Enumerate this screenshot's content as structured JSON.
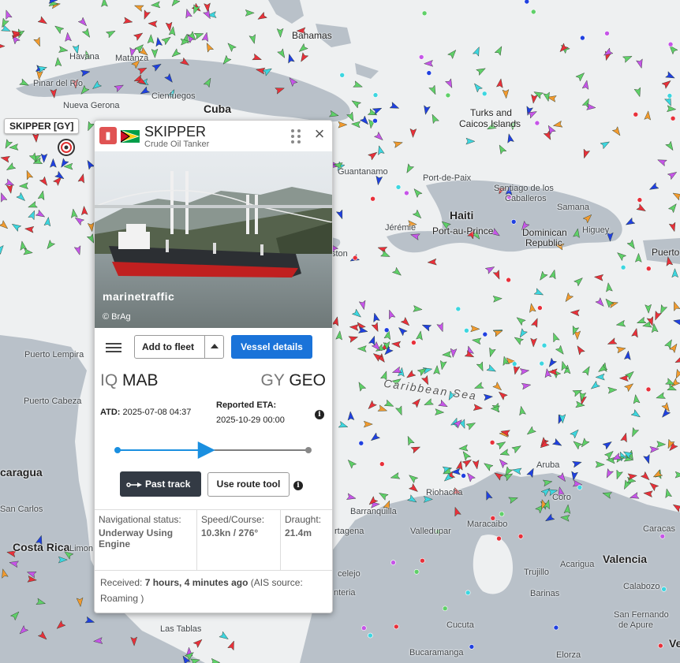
{
  "map": {
    "places": [
      {
        "name": "Bahamas",
        "cls": "mid"
      },
      {
        "name": "Havana",
        "cls": ""
      },
      {
        "name": "Matanza",
        "cls": ""
      },
      {
        "name": "Pinar del Rio",
        "cls": ""
      },
      {
        "name": "Nueva Gerona",
        "cls": ""
      },
      {
        "name": "Cienfuegos",
        "cls": ""
      },
      {
        "name": "Cuba",
        "cls": "big"
      },
      {
        "name": "Turks and",
        "cls": "mid"
      },
      {
        "name": "Caicos Islands",
        "cls": "mid"
      },
      {
        "name": "Guantanamo",
        "cls": ""
      },
      {
        "name": "Port-de-Paix",
        "cls": ""
      },
      {
        "name": "Santiago de los",
        "cls": ""
      },
      {
        "name": "Caballeros",
        "cls": ""
      },
      {
        "name": "Samana",
        "cls": ""
      },
      {
        "name": "Haiti",
        "cls": "big"
      },
      {
        "name": "Jérémie",
        "cls": ""
      },
      {
        "name": "Port-au-Prince",
        "cls": "mid"
      },
      {
        "name": "Dominican",
        "cls": "mid"
      },
      {
        "name": "Republic",
        "cls": "mid"
      },
      {
        "name": "Higuey",
        "cls": ""
      },
      {
        "name": "Puerto",
        "cls": "mid"
      },
      {
        "name": "ston",
        "cls": ""
      },
      {
        "name": "Caribbean Sea",
        "cls": "sea"
      },
      {
        "name": "Puerto Lempira",
        "cls": ""
      },
      {
        "name": "Puerto Cabeza",
        "cls": ""
      },
      {
        "name": "caragua",
        "cls": "big"
      },
      {
        "name": "San Carlos",
        "cls": ""
      },
      {
        "name": "Costa Rica",
        "cls": "big"
      },
      {
        "name": "Limon",
        "cls": ""
      },
      {
        "name": "Las Tablas",
        "cls": ""
      },
      {
        "name": "Aruba",
        "cls": ""
      },
      {
        "name": "Coro",
        "cls": ""
      },
      {
        "name": "Riohacha",
        "cls": ""
      },
      {
        "name": "Barranquilla",
        "cls": ""
      },
      {
        "name": "Valledupar",
        "cls": ""
      },
      {
        "name": "Maracaibo",
        "cls": ""
      },
      {
        "name": "rtagena",
        "cls": ""
      },
      {
        "name": "celejo",
        "cls": ""
      },
      {
        "name": "nteria",
        "cls": ""
      },
      {
        "name": "Trujillo",
        "cls": ""
      },
      {
        "name": "Acarigua",
        "cls": ""
      },
      {
        "name": "Valencia",
        "cls": "big"
      },
      {
        "name": "Calabozo",
        "cls": ""
      },
      {
        "name": "Barinas",
        "cls": ""
      },
      {
        "name": "San Fernando",
        "cls": ""
      },
      {
        "name": "de Apure",
        "cls": ""
      },
      {
        "name": "Cucuta",
        "cls": ""
      },
      {
        "name": "Bucaramanga",
        "cls": ""
      },
      {
        "name": "Elorza",
        "cls": ""
      },
      {
        "name": "Caracas",
        "cls": ""
      },
      {
        "name": "Ve",
        "cls": "big"
      }
    ]
  },
  "vessel_label": "SKIPPER [GY]",
  "popup": {
    "name": "SKIPPER",
    "type": "Crude Oil Tanker",
    "photo_watermark": "marinetraffic",
    "photo_credit": "© BrAg",
    "add_to_fleet": "Add to fleet",
    "vessel_details": "Vessel details",
    "from_cc": "IQ",
    "from_port": "MAB",
    "to_cc": "GY",
    "to_port": "GEO",
    "atd_label": "ATD:",
    "atd_value": "2025-07-08 04:37",
    "eta_label": "Reported ETA:",
    "eta_value": "2025-10-29 00:00",
    "progress": 0.47,
    "past_track": "Past track",
    "route_tool": "Use route tool",
    "nav_status_label": "Navigational status:",
    "nav_status_value": "Underway Using Engine",
    "speed_label": "Speed/Course:",
    "speed_value": "10.3kn / 276°",
    "draught_label": "Draught:",
    "draught_value": "21.4m",
    "received_label": "Received:",
    "received_value": "7 hours, 4 minutes ago",
    "received_source": "(AIS source: Roaming )"
  },
  "colors": {
    "accent": "#1a73d9",
    "dark_button": "#333a44",
    "land": "#b9c1c9",
    "sea": "#eef0f1"
  }
}
